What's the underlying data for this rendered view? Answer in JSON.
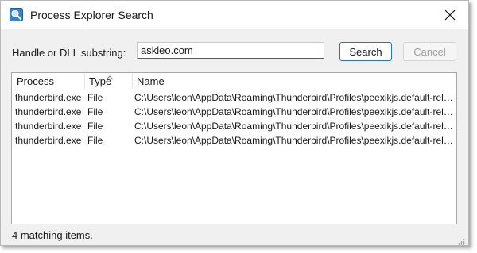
{
  "window": {
    "title": "Process Explorer Search"
  },
  "form": {
    "label": "Handle or DLL substring:",
    "input_value": "askleo.com",
    "search_label": "Search",
    "cancel_label": "Cancel"
  },
  "table": {
    "columns": [
      "Process",
      "Type",
      "Name"
    ],
    "sort_column": "Type",
    "rows": [
      {
        "process": "thunderbird.exe",
        "type": "File",
        "name": "C:\\Users\\leon\\AppData\\Roaming\\Thunderbird\\Profiles\\peexikjs.default-release"
      },
      {
        "process": "thunderbird.exe",
        "type": "File",
        "name": "C:\\Users\\leon\\AppData\\Roaming\\Thunderbird\\Profiles\\peexikjs.default-release"
      },
      {
        "process": "thunderbird.exe",
        "type": "File",
        "name": "C:\\Users\\leon\\AppData\\Roaming\\Thunderbird\\Profiles\\peexikjs.default-release"
      },
      {
        "process": "thunderbird.exe",
        "type": "File",
        "name": "C:\\Users\\leon\\AppData\\Roaming\\Thunderbird\\Profiles\\peexikjs.default-release"
      }
    ]
  },
  "status": {
    "text": "4 matching items."
  },
  "icons": {
    "app": "process-explorer-icon",
    "close": "close-icon",
    "sort": "sort-ascending-icon",
    "grip": "resize-grip-icon"
  },
  "colors": {
    "accent": "#2f6fc7",
    "window_bg": "#f0f0f0",
    "title_bg": "#ffffff"
  }
}
